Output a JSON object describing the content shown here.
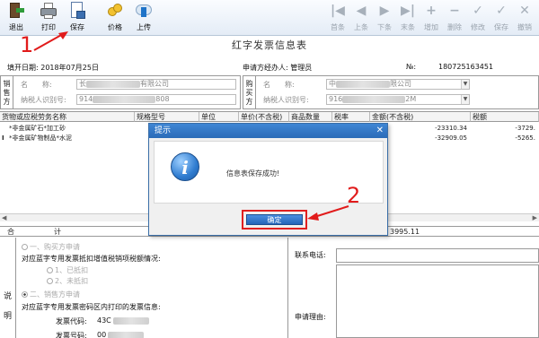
{
  "toolbar": {
    "exit": "退出",
    "print": "打印",
    "save": "保存",
    "price": "价格",
    "upload": "上传",
    "first": "首条",
    "prev": "上条",
    "next": "下条",
    "last": "末条",
    "add": "增加",
    "delete": "删除",
    "modify": "修改",
    "save2": "保存",
    "cancel": "撤销"
  },
  "annotations": {
    "step1": "1",
    "step2": "2"
  },
  "title": "红字发票信息表",
  "info": {
    "fill_date": "填开日期: 2018年07月25日",
    "handler": "申请方经办人: 管理员",
    "number_label": "№:",
    "number_value": "180725163451"
  },
  "seller": {
    "side_label": "销售方",
    "name_label": "名　　称:",
    "name_value": "长",
    "name_tail": "有限公司",
    "tax_label": "纳税人识别号:",
    "tax_value": "914",
    "tax_tail": "808"
  },
  "buyer": {
    "side_label": "购买方",
    "name_label": "名　　称:",
    "name_value": "中",
    "name_tail": "限公司",
    "tax_label": "纳税人识别号:",
    "tax_value": "916",
    "tax_tail": "2M"
  },
  "grid": {
    "headers": [
      "货物或应税劳务名称",
      "规格型号",
      "单位",
      "单价(不含税)",
      "商品数量",
      "税率",
      "金额(不含税)",
      "税额"
    ],
    "rows": [
      {
        "name": "*非金属矿石*加工砂",
        "amount": "-23310.34",
        "tax": "-3729."
      },
      {
        "name": "*非金属矿物制品*水泥",
        "amount": "-32909.05",
        "tax": "-5265."
      }
    ],
    "row_marker": "I"
  },
  "total": {
    "label_a": "合",
    "label_b": "计",
    "value": "3995.11"
  },
  "lower": {
    "side": "说明",
    "buyer_apply": "一、购买方申请",
    "buyer_q": "对应蓝字专用发票抵扣增值税销项税额情况:",
    "opt1": "1、已抵扣",
    "opt2": "2、未抵扣",
    "seller_apply": "二、销售方申请",
    "seller_q": "对应蓝字专用发票密码区内打印的发票信息:",
    "code_label": "发票代码:",
    "code_value": "43C",
    "num_label": "发票号码:",
    "num_value": "00",
    "contact_label": "联系电话:",
    "reason_label": "申请理由:"
  },
  "modal": {
    "title": "提示",
    "close": "✕",
    "icon": "info-icon",
    "message": "信息表保存成功!",
    "ok": "确定"
  },
  "colors": {
    "accent": "#2b6bb8",
    "annotation": "#e11b1b"
  }
}
